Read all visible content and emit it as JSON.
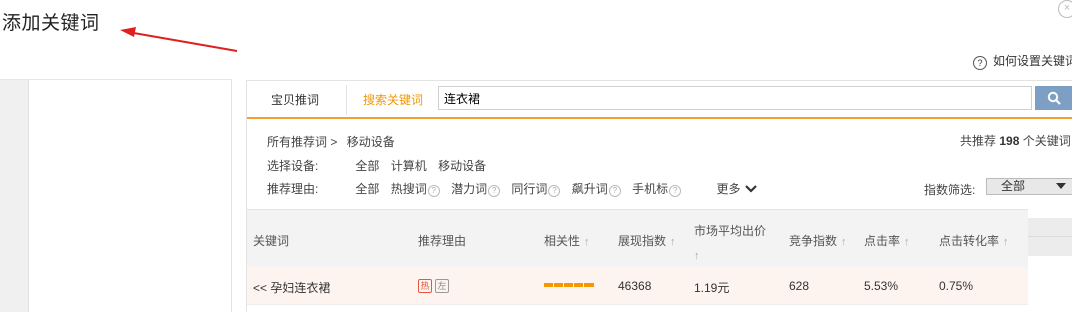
{
  "dialog": {
    "title": "添加关键词",
    "close_icon": "×",
    "help_icon": "?",
    "help_text": "如何设置关键词"
  },
  "tabs": [
    {
      "label": "宝贝推词"
    },
    {
      "label": "搜索关键词"
    }
  ],
  "search": {
    "value": "连衣裙"
  },
  "breadcrumb": {
    "all": "所有推荐词 >",
    "current": "移动设备"
  },
  "device": {
    "label": "选择设备:",
    "options": [
      "全部",
      "计算机",
      "移动设备"
    ]
  },
  "reason": {
    "label": "推荐理由:",
    "options": [
      "全部",
      "热搜词",
      "潜力词",
      "同行词",
      "飙升词",
      "手机标"
    ],
    "help_mark": "?",
    "more": "更多"
  },
  "total": {
    "prefix": "共推荐",
    "count": "198",
    "suffix": "个关键词"
  },
  "index_filter": {
    "label": "指数筛选:",
    "value": "全部"
  },
  "table": {
    "headers": [
      "关键词",
      "推荐理由",
      "相关性",
      "展现指数",
      "市场平均出价",
      "竞争指数",
      "点击率",
      "点击转化率"
    ],
    "sort_icon": "↑",
    "rows": [
      {
        "keyword": "<< 孕妇连衣裙",
        "tags": [
          "热",
          "左"
        ],
        "relevance": 1.0,
        "impressions": "46368",
        "avg_bid": "1.19元",
        "competition": "628",
        "ctr": "5.53%",
        "cvr": "0.75%"
      }
    ]
  },
  "colors": {
    "accent": "#f39800",
    "search_button": "#7d9fc4",
    "annotation_arrow": "#e02020",
    "row_highlight": "#fdf4ef"
  }
}
